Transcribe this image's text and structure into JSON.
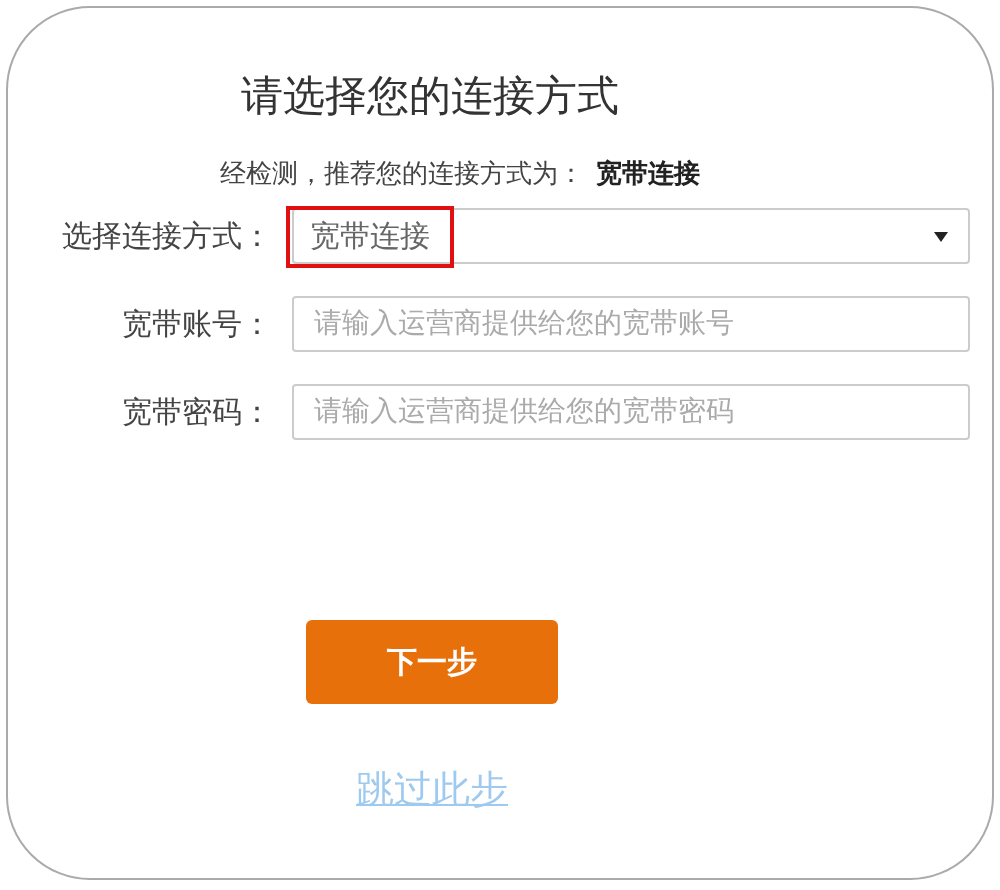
{
  "title": "请选择您的连接方式",
  "recommendation": {
    "label": "经检测，推荐您的连接方式为：",
    "value": "宽带连接"
  },
  "fields": [
    {
      "kind": "select",
      "label": "选择连接方式：",
      "value": "宽带连接",
      "highlighted": true
    },
    {
      "kind": "text",
      "label": "宽带账号：",
      "placeholder": "请输入运营商提供给您的宽带账号"
    },
    {
      "kind": "password",
      "label": "宽带密码：",
      "placeholder": "请输入运营商提供给您的宽带密码"
    }
  ],
  "next_button": "下一步",
  "skip_link": "跳过此步"
}
